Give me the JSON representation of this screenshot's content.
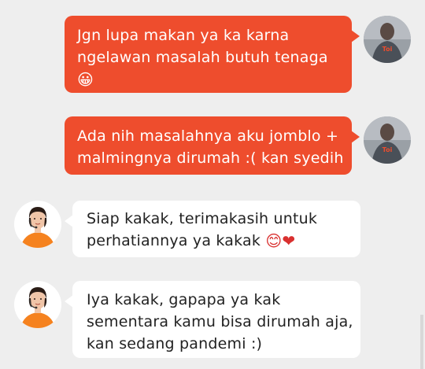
{
  "messages": [
    {
      "direction": "outgoing",
      "lines": [
        "Jgn lupa makan ya ka karna",
        "ngelawan masalah butuh tenaga"
      ],
      "emoji": "😀"
    },
    {
      "direction": "outgoing",
      "lines": [
        "Ada nih masalahnya aku jomblo +",
        "malmingnya dirumah :( kan syedih"
      ]
    },
    {
      "direction": "incoming",
      "lines": [
        "Siap kakak, terimakasih untuk",
        "perhatiannya ya kakak"
      ],
      "emoji": "😊❤"
    },
    {
      "direction": "incoming",
      "lines": [
        "Iya kakak, gapapa ya kak",
        "sementara kamu bisa dirumah aja,",
        "kan sedang pandemi :)"
      ]
    }
  ],
  "avatars": {
    "user": "user-avatar",
    "agent": "support-agent-avatar",
    "user_shirt_text": "Toi"
  },
  "colors": {
    "outgoing_bubble": "#ee4d2d",
    "incoming_bubble": "#ffffff",
    "background": "#eeeeee",
    "agent_shirt": "#f5821f"
  }
}
